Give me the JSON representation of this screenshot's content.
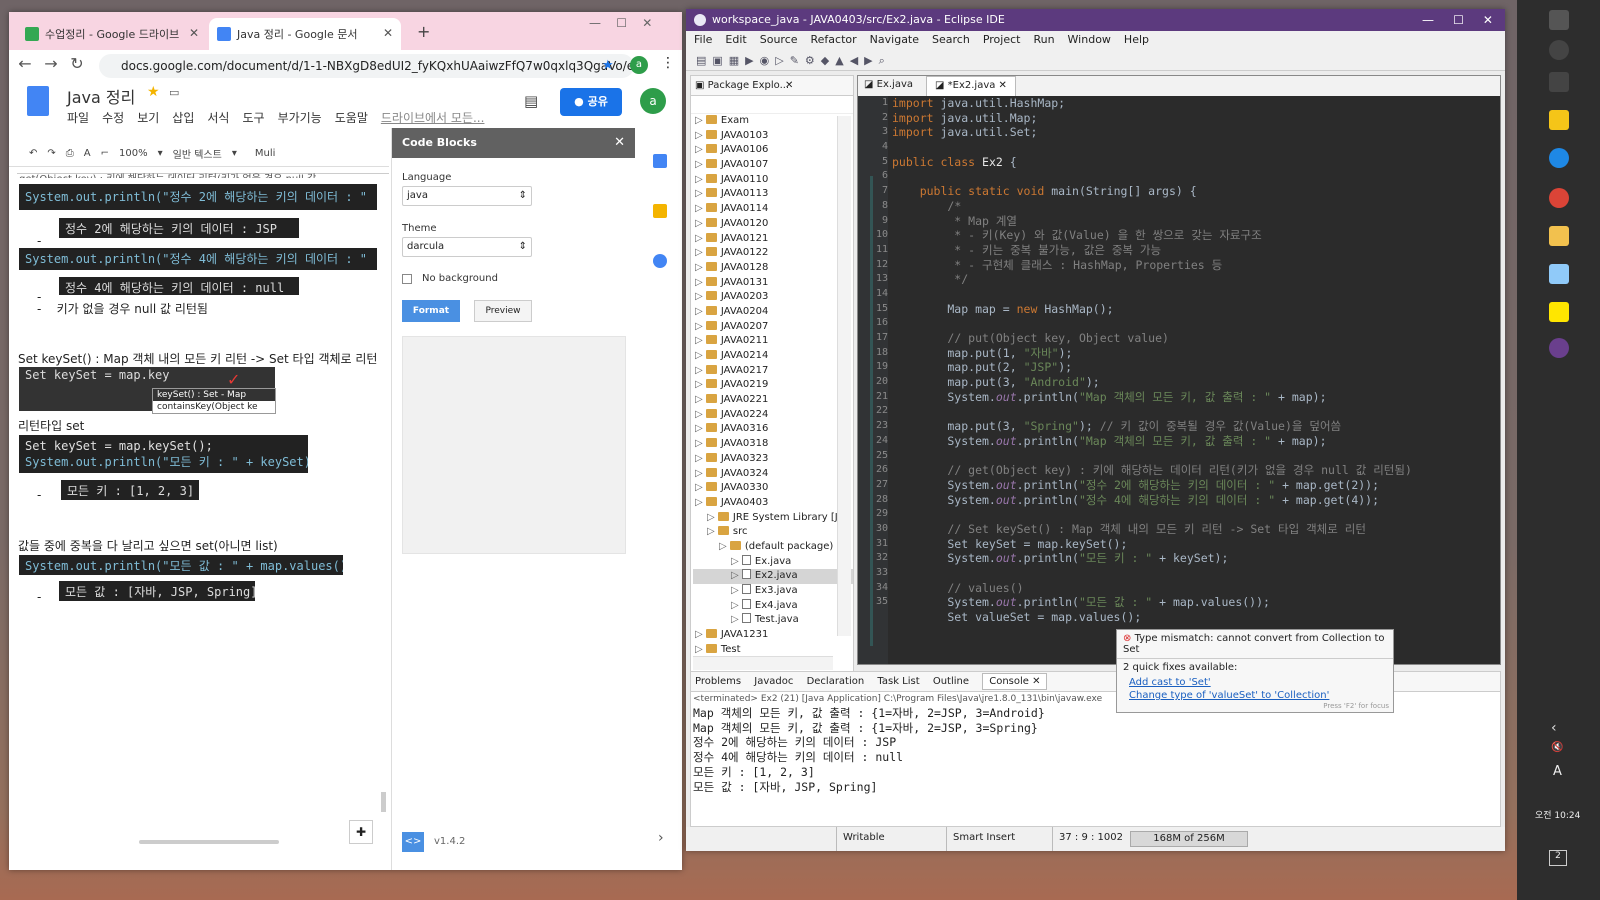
{
  "chrome": {
    "tabs": [
      {
        "label": "수업정리 - Google 드라이브",
        "color": "#34a853"
      },
      {
        "label": "Java 정리 - Google 문서",
        "color": "#4285f4"
      }
    ],
    "new_tab": "+",
    "url": "docs.google.com/document/d/1-1-NBXgD8edUI2_fyKQxhUAaiwzFfQ7w0qxlq3QgaVo/e...",
    "profile": "a"
  },
  "docs": {
    "title": "Java 정리",
    "menu": [
      "파일",
      "수정",
      "보기",
      "삽입",
      "서식",
      "도구",
      "부가기능",
      "도움말"
    ],
    "drive_link": "드라이브에서 모든...",
    "share": "공유",
    "toolbar": {
      "zoom": "100%",
      "style": "일반 텍스트",
      "font": "Muli"
    },
    "content": {
      "top_cut": "get(Object key) : 키에 해당하는 데이터 리턴(키가 없을 경우 null 값",
      "code1": "System.out.println(\"정수 2에 해당하는 키의 데이터 : \"",
      "out1": "정수 2에 해당하는 키의 데이터 : JSP",
      "code2": "System.out.println(\"정수 4에 해당하는 키의 데이터 : \"",
      "out2": "정수 4에 해당하는 키의 데이터 : null",
      "bullet_null": "키가 없을 경우 null 값 리턴됨",
      "keyset_heading": "Set keySet() : Map 객체 내의 모든 키 리턴 -> Set 타입 객체로 리턴",
      "autocomplete_code": "Set keySet = map.key",
      "autocomplete_items": [
        "keySet() : Set - Map",
        "containsKey(Object ke"
      ],
      "return_type": "리턴타입 set",
      "code3a": "Set keySet = map.keySet();",
      "code3b": "System.out.println(\"모든 키 : \" + keySet);",
      "out3": "모든 키 : [1, 2, 3]",
      "values_heading": "값들 중에 중복을 다 날리고 싶으면 set(아니면 list)",
      "code4": "System.out.println(\"모든 값 : \" + map.values());",
      "out4": "모든 값 : [자바, JSP, Spring]"
    },
    "codeblocks": {
      "title": "Code Blocks",
      "language_label": "Language",
      "language": "java",
      "theme_label": "Theme",
      "theme": "darcula",
      "no_bg": "No background",
      "format": "Format",
      "preview": "Preview",
      "version": "v1.4.2"
    }
  },
  "eclipse": {
    "title": "workspace_java - JAVA0403/src/Ex2.java - Eclipse IDE",
    "menu": [
      "File",
      "Edit",
      "Source",
      "Refactor",
      "Navigate",
      "Search",
      "Project",
      "Run",
      "Window",
      "Help"
    ],
    "package_title": "Package Explo...",
    "packages": [
      "Exam",
      "JAVA0103",
      "JAVA0106",
      "JAVA0107",
      "JAVA0110",
      "JAVA0113",
      "JAVA0114",
      "JAVA0120",
      "JAVA0121",
      "JAVA0122",
      "JAVA0128",
      "JAVA0131",
      "JAVA0203",
      "JAVA0204",
      "JAVA0207",
      "JAVA0211",
      "JAVA0214",
      "JAVA0217",
      "JAVA0219",
      "JAVA0221",
      "JAVA0224",
      "JAVA0316",
      "JAVA0318",
      "JAVA0323",
      "JAVA0324",
      "JAVA0330",
      "JAVA0403"
    ],
    "sub": {
      "jre": "JRE System Library [Jav",
      "src": "src",
      "pkg": "(default package)",
      "files": [
        "Ex.java",
        "Ex2.java",
        "Ex3.java",
        "Ex4.java",
        "Test.java"
      ],
      "after": "JAVA1231",
      "after2": "Test"
    },
    "editor_tabs": [
      "Ex.java",
      "*Ex2.java"
    ],
    "code": [
      {
        "n": "1",
        "h": "<span class='kw'>import</span> java.util.HashMap;"
      },
      {
        "n": "2",
        "h": "<span class='kw'>import</span> java.util.Map;"
      },
      {
        "n": "3",
        "h": "<span class='kw'>import</span> java.util.Set;"
      },
      {
        "n": "4",
        "h": ""
      },
      {
        "n": "5",
        "h": "<span class='kw'>public class</span> <span class='cls'>Ex2</span> {"
      },
      {
        "n": "6",
        "h": ""
      },
      {
        "n": "7",
        "h": "    <span class='kw'>public static void</span> main(String[] args) {"
      },
      {
        "n": "8",
        "h": "        <span class='cm'>/*</span>"
      },
      {
        "n": "9",
        "h": "<span class='cm'>         * Map 계열</span>"
      },
      {
        "n": "10",
        "h": "<span class='cm'>         * - 키(Key) 와 값(Value) 을 한 쌍으로 갖는 자료구조</span>"
      },
      {
        "n": "11",
        "h": "<span class='cm'>         * - 키는 중복 불가능, 값은 중복 가능</span>"
      },
      {
        "n": "12",
        "h": "<span class='cm'>         * - 구현체 클래스 : HashMap, Properties 등</span>"
      },
      {
        "n": "13",
        "h": "<span class='cm'>         */</span>"
      },
      {
        "n": "14",
        "h": ""
      },
      {
        "n": "15",
        "h": "        Map map = <span class='kw'>new</span> HashMap();"
      },
      {
        "n": "16",
        "h": ""
      },
      {
        "n": "17",
        "h": "        <span class='cm'>// put(Object key, Object value)</span>"
      },
      {
        "n": "18",
        "h": "        map.put(1, <span class='str'>\"자바\"</span>);"
      },
      {
        "n": "19",
        "h": "        map.put(2, <span class='str'>\"JSP\"</span>);"
      },
      {
        "n": "20",
        "h": "        map.put(3, <span class='str'>\"Android\"</span>);"
      },
      {
        "n": "21",
        "h": "        System.<span class='fn'>out</span>.println(<span class='str'>\"Map 객체의 모든 키, 값 출력 : \"</span> + map);"
      },
      {
        "n": "22",
        "h": ""
      },
      {
        "n": "23",
        "h": "        map.put(3, <span class='str'>\"Spring\"</span>); <span class='cm'>// 키 값이 중복될 경우 값(Value)을 덮어씀</span>"
      },
      {
        "n": "24",
        "h": "        System.<span class='fn'>out</span>.println(<span class='str'>\"Map 객체의 모든 키, 값 출력 : \"</span> + map);"
      },
      {
        "n": "25",
        "h": ""
      },
      {
        "n": "26",
        "h": "        <span class='cm'>// get(Object key) : 키에 해당하는 데이터 리턴(키가 없을 경우 null 값 리턴됨)</span>"
      },
      {
        "n": "27",
        "h": "        System.<span class='fn'>out</span>.println(<span class='str'>\"정수 2에 해당하는 키의 데이터 : \"</span> + map.get(2));"
      },
      {
        "n": "28",
        "h": "        System.<span class='fn'>out</span>.println(<span class='str'>\"정수 4에 해당하는 키의 데이터 : \"</span> + map.get(4));"
      },
      {
        "n": "29",
        "h": ""
      },
      {
        "n": "30",
        "h": "        <span class='cm'>// Set keySet() : Map 객체 내의 모든 키 리턴 -> Set 타입 객체로 리턴</span>"
      },
      {
        "n": "31",
        "h": "        Set keySet = map.keySet();"
      },
      {
        "n": "32",
        "h": "        System.<span class='fn'>out</span>.println(<span class='str'>\"모든 키 : \"</span> + keySet);"
      },
      {
        "n": "33",
        "h": ""
      },
      {
        "n": "34",
        "h": "        <span class='cm'>// values()</span>"
      },
      {
        "n": "35",
        "h": "        System.<span class='fn'>out</span>.println(<span class='str'>\"모든 값 : \"</span> + map.values());"
      },
      {
        "n": "",
        "h": "        Set valueSet = map.values();"
      }
    ],
    "quickfix": {
      "error": "Type mismatch: cannot convert from Collection to Set",
      "count": "2 quick fixes available:",
      "fix1": "Add cast to 'Set'",
      "fix2": "Change type of 'valueSet' to 'Collection'",
      "hint": "Press 'F2' for focus"
    },
    "bottom_tabs": [
      "Problems",
      "Javadoc",
      "Declaration",
      "Task List",
      "Outline",
      "Console"
    ],
    "console_header": "<terminated> Ex2 (21) [Java Application] C:\\Program Files\\Java\\jre1.8.0_131\\bin\\javaw.exe",
    "console": [
      "Map 객체의 모든 키, 값 출력 : {1=자바, 2=JSP, 3=Android}",
      "Map 객체의 모든 키, 값 출력 : {1=자바, 2=JSP, 3=Spring}",
      "정수 2에 해당하는 키의 데이터 : JSP",
      "정수 4에 해당하는 키의 데이터 : null",
      "모든 키 : [1, 2, 3]",
      "모든 값 : [자바, JSP, Spring]"
    ],
    "status": {
      "writable": "Writable",
      "insert": "Smart Insert",
      "pos": "37 : 9 : 1002",
      "heap": "168M of 256M"
    }
  },
  "taskbar": {
    "clock": "오전 10:24",
    "lang": "A",
    "notif": "2"
  }
}
